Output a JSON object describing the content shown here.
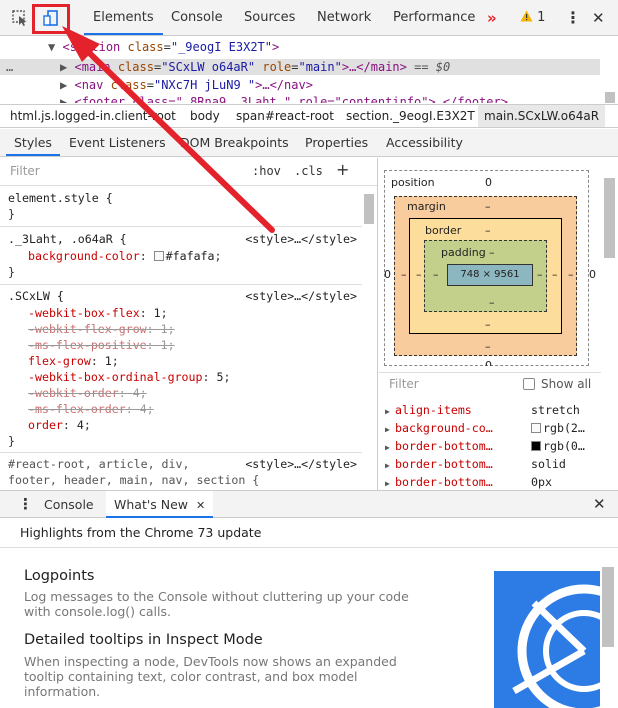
{
  "toolbar": {
    "tabs": [
      "Elements",
      "Console",
      "Sources",
      "Network",
      "Performance"
    ],
    "more_tabs": "»",
    "warning_count": "1",
    "menu": "⋮",
    "close": "✕"
  },
  "tree": {
    "line1": {
      "tag_open": "<section",
      "attr": "class",
      "value": "\"_9eogI E3X2T\"",
      "tag_close": ">"
    },
    "line2": {
      "tag_open": "<main",
      "attr1": "class",
      "value1": "\"SCxLW  o64aR\"",
      "attr2": "role",
      "value2": "\"main\"",
      "ellipsis": ">…</main>",
      "eq": "== $0"
    },
    "line3": {
      "tag_open": "<nav",
      "attr": "class",
      "value": "\"NXc7H jLuN9  \"",
      "rest": ">…</nav>"
    },
    "line4": {
      "text": "<footer class=\"_8Rna9 _3Laht \" role=\"contentinfo\">…</footer>"
    },
    "dots": "…"
  },
  "breadcrumbs": [
    "html.js.logged-in.client-root",
    "body",
    "span#react-root",
    "section._9eogI.E3X2T",
    "main.SCxLW.o64aR"
  ],
  "sidebar_tabs": [
    "Styles",
    "Event Listeners",
    "DOM Breakpoints",
    "Properties",
    "Accessibility"
  ],
  "styles": {
    "filter_placeholder": "Filter",
    "hov": ":hov",
    "cls": ".cls",
    "plus": "+",
    "rules": [
      {
        "selector": "element.style {",
        "source": "",
        "props": [],
        "close": "}"
      },
      {
        "selector": "._3Laht, .o64aR {",
        "source": "<style>…</style>",
        "props": [
          {
            "name": "background-color",
            "value": "#fafafa",
            "swatch": "#fafafa",
            "struck": false
          }
        ],
        "close": "}"
      },
      {
        "selector": ".SCxLW {",
        "source": "<style>…</style>",
        "props": [
          {
            "name": "-webkit-box-flex",
            "value": "1",
            "struck": false
          },
          {
            "name": "-webkit-flex-grow",
            "value": "1",
            "struck": true
          },
          {
            "name": "-ms-flex-positive",
            "value": "1",
            "struck": true
          },
          {
            "name": "flex-grow",
            "value": "1",
            "struck": false
          },
          {
            "name": "-webkit-box-ordinal-group",
            "value": "5",
            "struck": false
          },
          {
            "name": "-webkit-order",
            "value": "4",
            "struck": true
          },
          {
            "name": "-ms-flex-order",
            "value": "4",
            "struck": true
          },
          {
            "name": "order",
            "value": "4",
            "struck": false
          }
        ],
        "close": "}"
      },
      {
        "selector": "#react-root, article, div,",
        "selector2": "footer, header, main, nav, section {",
        "source": "<style>…</style>",
        "props": []
      }
    ]
  },
  "boxmodel": {
    "position_label": "position",
    "position_value": "0",
    "margin_label": "margin",
    "border_label": "border",
    "padding_label": "padding",
    "dash": "–",
    "content": "748 × 9561",
    "left_zero": "0",
    "right_zero": "0",
    "bottom_zero": "0"
  },
  "computed": {
    "filter_placeholder": "Filter",
    "show_all": "Show all",
    "rows": [
      {
        "name": "align-items",
        "value": "stretch",
        "swatch": null
      },
      {
        "name": "background-co…",
        "value": "rgb(2…",
        "swatch": "#fafafa"
      },
      {
        "name": "border-bottom…",
        "value": "rgb(0…",
        "swatch": "#000000"
      },
      {
        "name": "border-bottom…",
        "value": "solid",
        "swatch": null
      },
      {
        "name": "border-bottom…",
        "value": "0px",
        "swatch": null
      }
    ]
  },
  "drawer": {
    "menu": "⋮",
    "tabs": [
      "Console",
      "What's New"
    ],
    "tab_close": "✕",
    "close": "✕",
    "highlights": "Highlights from the Chrome 73 update",
    "items": [
      {
        "title": "Logpoints",
        "desc": "Log messages to the Console without cluttering up your code with console.log() calls."
      },
      {
        "title": "Detailed tooltips in Inspect Mode",
        "desc": "When inspecting a node, DevTools now shows an expanded tooltip containing text, color contrast, and box model information."
      }
    ]
  },
  "colors": {
    "annotation_red": "#e4222b",
    "accent": "#1a73e8"
  }
}
